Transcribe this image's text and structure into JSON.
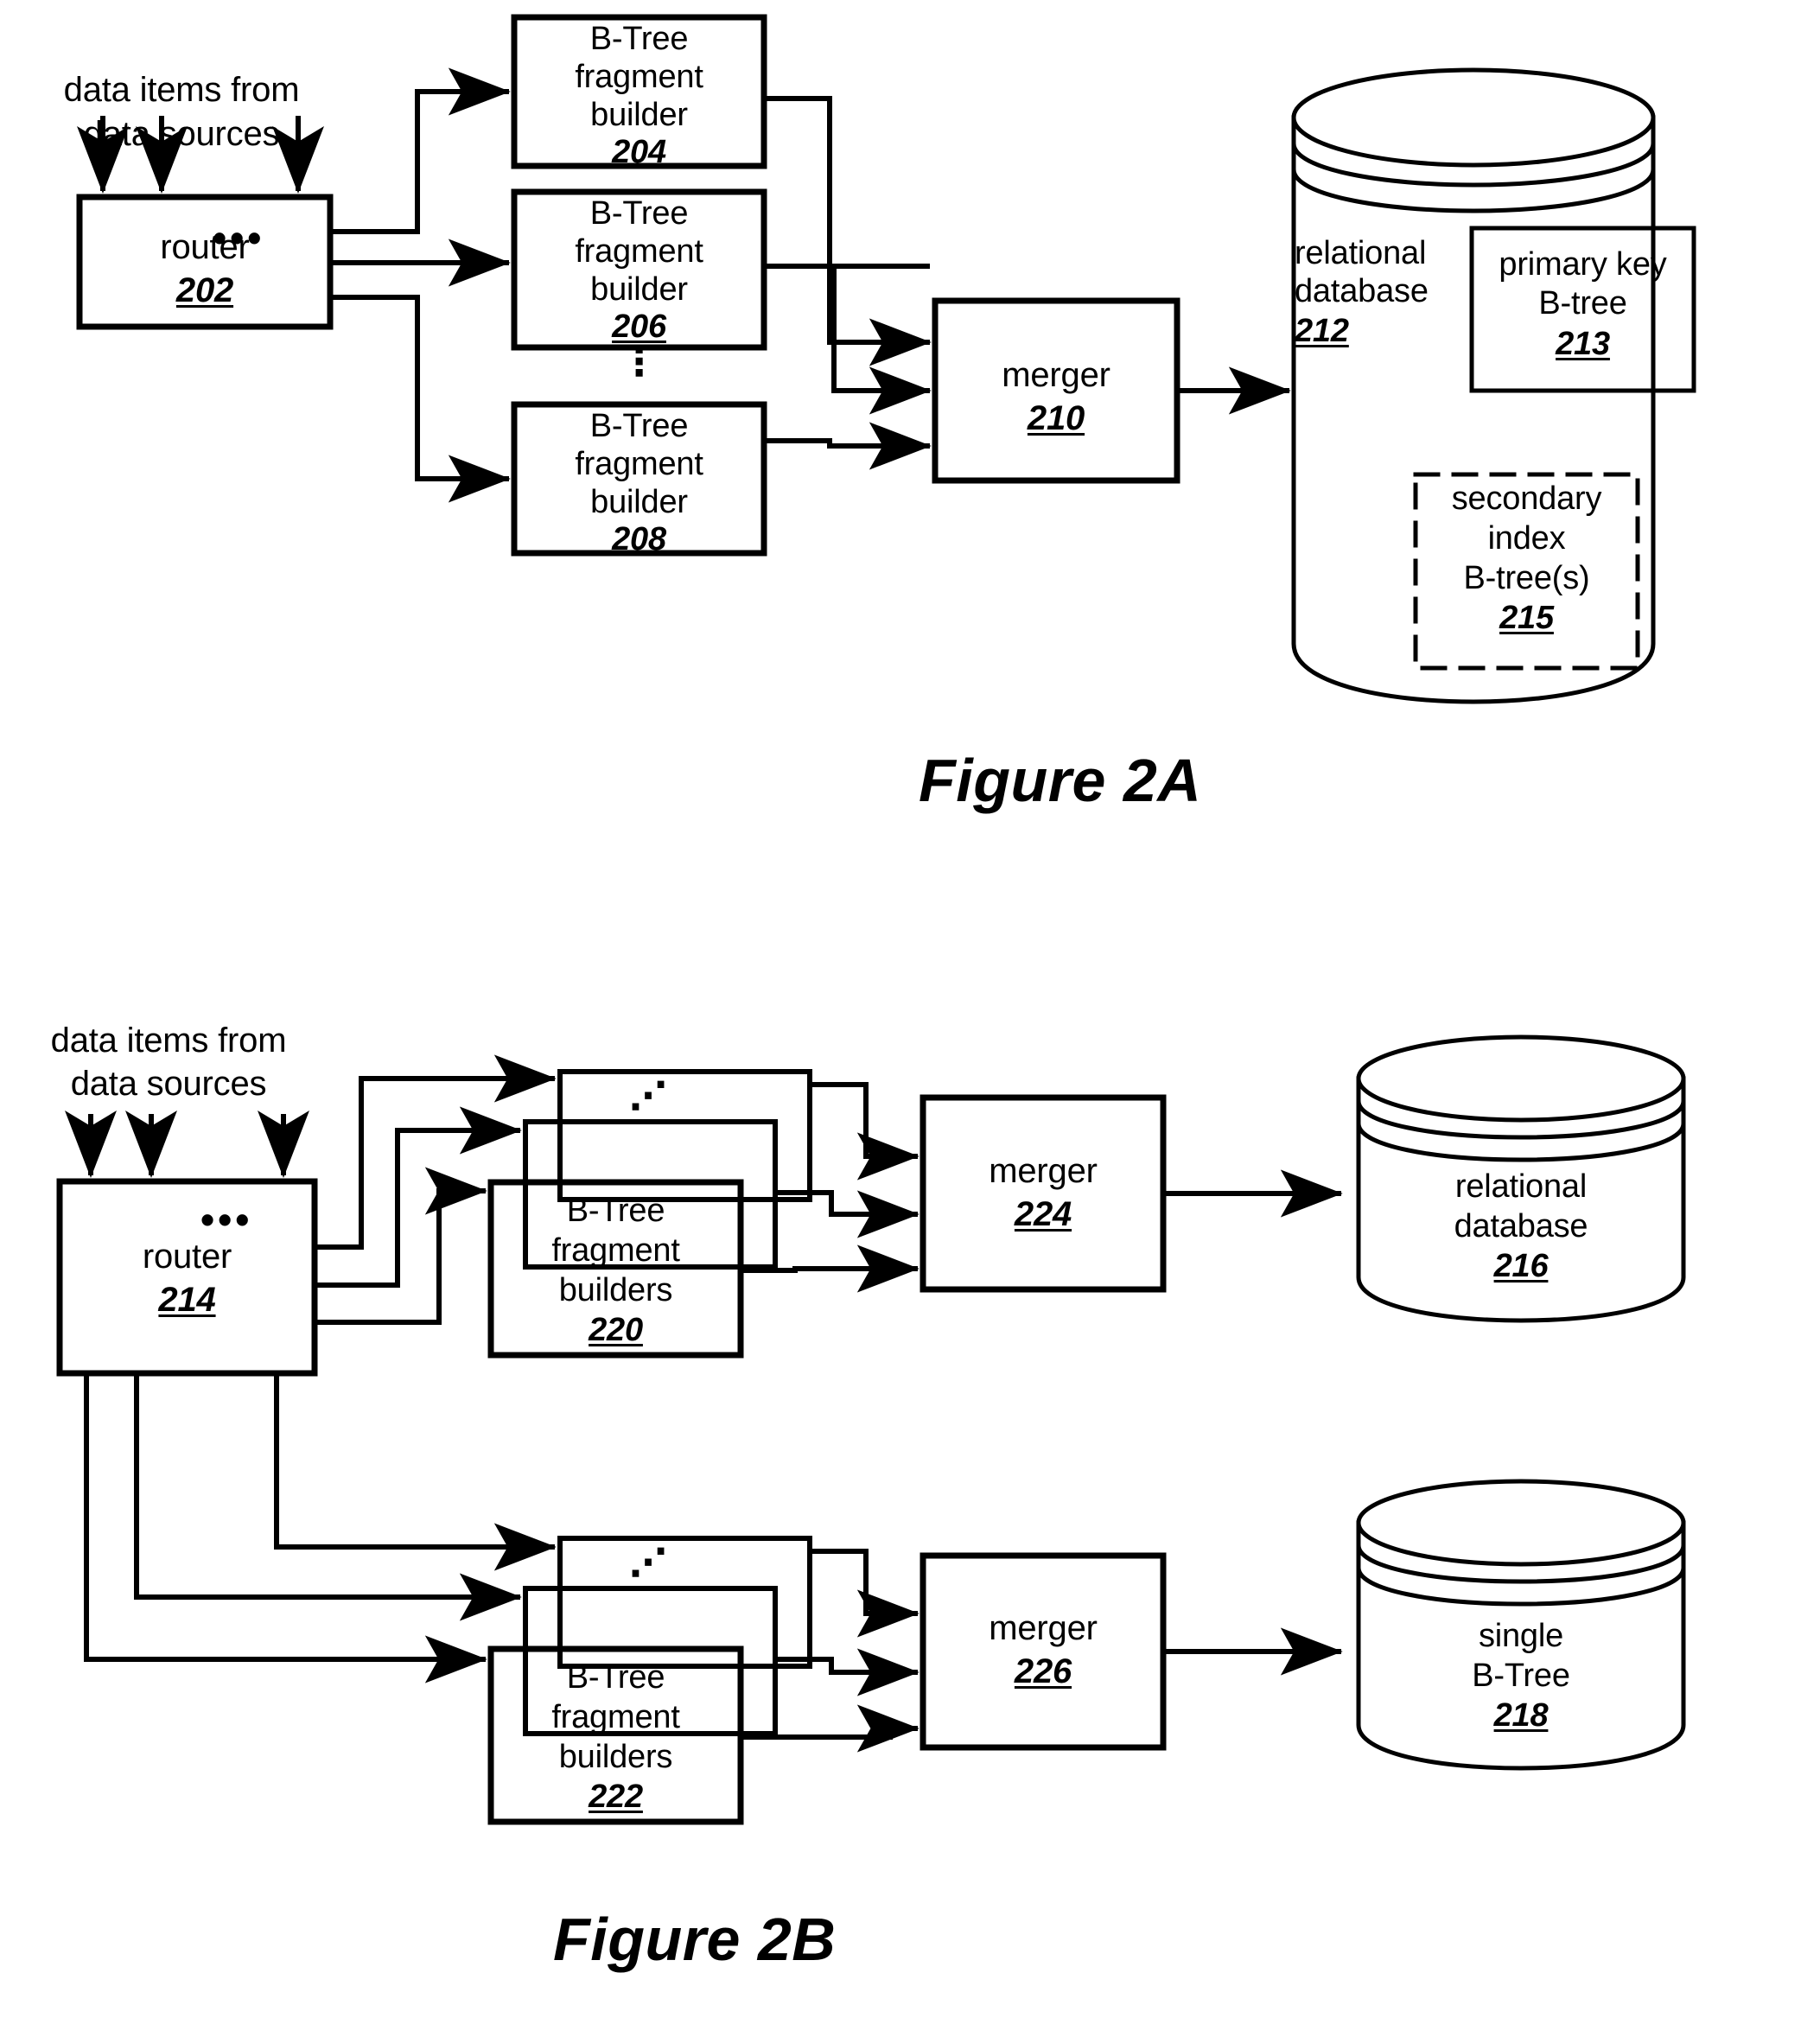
{
  "figures": [
    {
      "caption": "Figure 2A",
      "input_label_line1": "data items from",
      "input_label_line2": "data sources",
      "input_ellipsis": "•••",
      "router": {
        "name": "router",
        "ref": "202"
      },
      "builders": [
        {
          "line1": "B-Tree",
          "line2": "fragment",
          "line3": "builder",
          "ref": "204"
        },
        {
          "line1": "B-Tree",
          "line2": "fragment",
          "line3": "builder",
          "ref": "206"
        },
        {
          "line1": "B-Tree",
          "line2": "fragment",
          "line3": "builder",
          "ref": "208"
        }
      ],
      "vertical_ellipsis": "⋮",
      "merger": {
        "name": "merger",
        "ref": "210"
      },
      "store": {
        "line1": "relational",
        "line2": "database",
        "ref": "212",
        "inner_solid": {
          "line1": "primary key",
          "line2": "B-tree",
          "ref": "213"
        },
        "inner_dashed": {
          "line1": "secondary",
          "line2": "index",
          "line3": "B-tree(s)",
          "ref": "215"
        }
      }
    },
    {
      "caption": "Figure 2B",
      "input_label_line1": "data items from",
      "input_label_line2": "data sources",
      "input_ellipsis": "•••",
      "router": {
        "name": "router",
        "ref": "214"
      },
      "builder_stacks": [
        {
          "line1": "B-Tree",
          "line2": "fragment",
          "line3": "builders",
          "ref": "220",
          "stack_ellipsis": "⋰"
        },
        {
          "line1": "B-Tree",
          "line2": "fragment",
          "line3": "builders",
          "ref": "222",
          "stack_ellipsis": "⋰"
        }
      ],
      "mergers": [
        {
          "name": "merger",
          "ref": "224"
        },
        {
          "name": "merger",
          "ref": "226"
        }
      ],
      "stores": [
        {
          "line1": "relational",
          "line2": "database",
          "ref": "216"
        },
        {
          "line1": "single",
          "line2": "B-Tree",
          "ref": "218"
        }
      ]
    }
  ],
  "colors": {
    "ink": "#000000",
    "paper": "#ffffff"
  }
}
